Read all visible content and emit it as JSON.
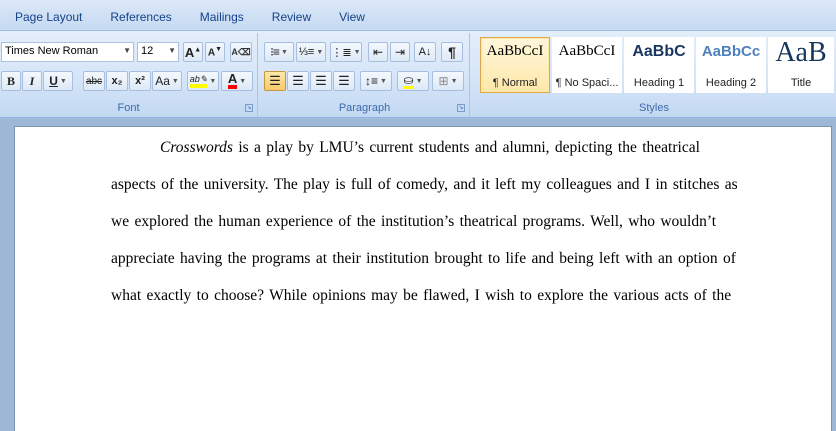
{
  "tabs": [
    "Page Layout",
    "References",
    "Mailings",
    "Review",
    "View"
  ],
  "font": {
    "name": "Times New Roman",
    "size": "12",
    "group_label": "Font",
    "grow_label": "A",
    "shrink_label": "A",
    "bold": "B",
    "italic": "I",
    "underline": "U",
    "strike": "abc",
    "subscript": "x₂",
    "superscript": "x²",
    "change_case": "Aa",
    "highlight": "ab",
    "font_color": "A"
  },
  "paragraph": {
    "group_label": "Paragraph",
    "pilcrow": "¶"
  },
  "styles": {
    "group_label": "Styles",
    "items": [
      {
        "sample": "AaBbCcI",
        "name": "¶ Normal"
      },
      {
        "sample": "AaBbCcI",
        "name": "¶ No Spaci..."
      },
      {
        "sample": "AaBbC",
        "name": "Heading 1"
      },
      {
        "sample": "AaBbCc",
        "name": "Heading 2"
      },
      {
        "sample": "AaB",
        "name": "Title"
      }
    ]
  },
  "colors": {
    "highlight": "#ffff00",
    "font_color": "#ff0000",
    "heading": "#17365d"
  },
  "document": {
    "line1_italic": "Crosswords",
    "line1_rest": " is a play by LMU’s current students and alumni,  depicting the theatrical",
    "line2": "aspects of the university. The play is full of comedy, and it left my colleagues and I in stitches as",
    "line3": "we explored the human experience of the institution’s theatrical programs.  Well, who wouldn’t",
    "line4": "appreciate having the programs at their institution brought to life and being left with an option of",
    "line5": "what exactly to choose? While opinions may be flawed, I wish to explore the various acts of the"
  }
}
